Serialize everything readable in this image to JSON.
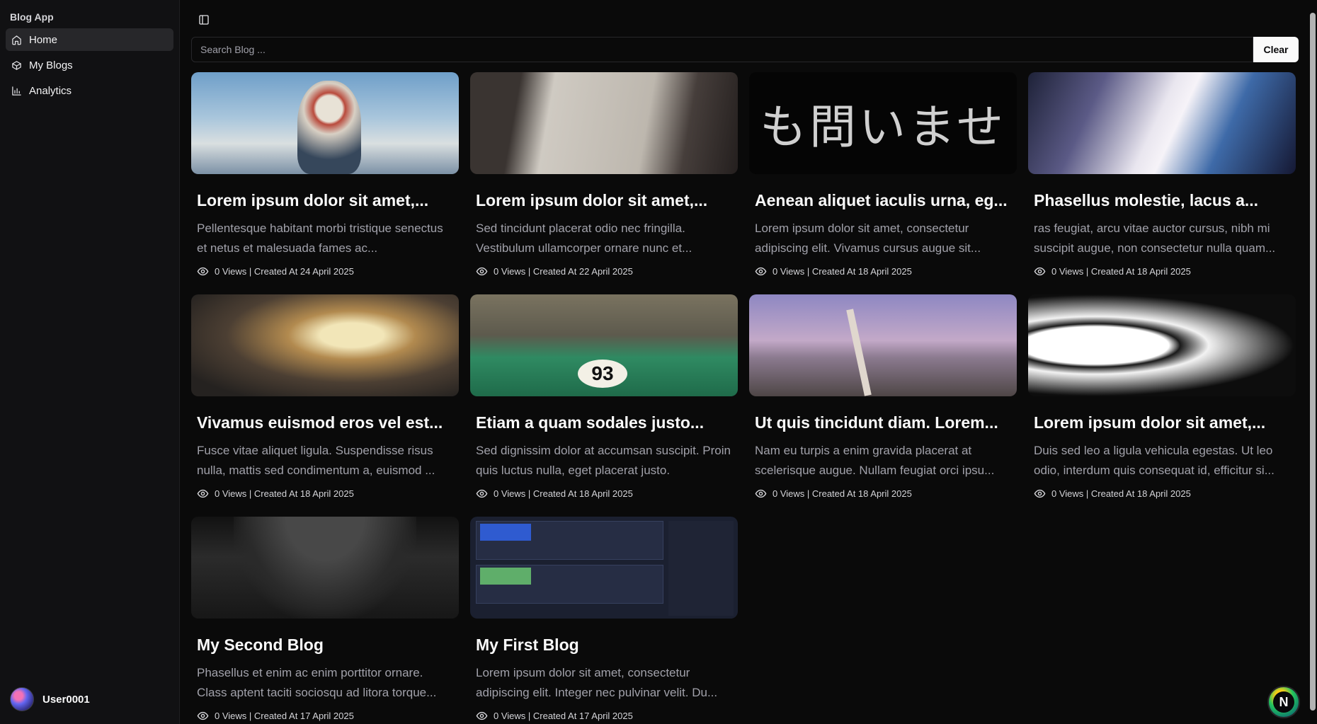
{
  "sidebar": {
    "app_name": "Blog App",
    "items": [
      {
        "label": "Home",
        "icon": "home-icon"
      },
      {
        "label": "My Blogs",
        "icon": "package-icon"
      },
      {
        "label": "Analytics",
        "icon": "chart-icon"
      }
    ],
    "user": {
      "name": "User0001"
    }
  },
  "search": {
    "placeholder": "Search Blog ...",
    "value": "",
    "clear_label": "Clear"
  },
  "posts": [
    {
      "title": "Lorem ipsum dolor sit amet,...",
      "desc": "Pellentesque habitant morbi tristique senectus et netus et malesuada fames ac...",
      "meta": "0 Views | Created At 24 April 2025"
    },
    {
      "title": "Lorem ipsum dolor sit amet,...",
      "desc": "Sed tincidunt placerat odio nec fringilla. Vestibulum ullamcorper ornare nunc et...",
      "meta": "0 Views | Created At 22 April 2025"
    },
    {
      "title": "Aenean aliquet iaculis urna, eg...",
      "desc": "Lorem ipsum dolor sit amet, consectetur adipiscing elit. Vivamus cursus augue sit...",
      "meta": "0 Views | Created At 18 April 2025",
      "image_text": "も問いませ"
    },
    {
      "title": "Phasellus molestie, lacus a...",
      "desc": "ras feugiat, arcu vitae auctor cursus, nibh mi suscipit augue, non consectetur nulla quam...",
      "meta": "0 Views | Created At 18 April 2025"
    },
    {
      "title": "Vivamus euismod eros vel est...",
      "desc": "Fusce vitae aliquet ligula. Suspendisse risus nulla, mattis sed condimentum a, euismod ...",
      "meta": "0 Views | Created At 18 April 2025"
    },
    {
      "title": "Etiam a quam sodales justo...",
      "desc": "Sed dignissim dolor at accumsan suscipit. Proin quis luctus nulla, eget placerat justo.",
      "meta": "0 Views | Created At 18 April 2025",
      "image_text": "93"
    },
    {
      "title": "Ut quis tincidunt diam. Lorem...",
      "desc": "Nam eu turpis a enim gravida placerat at scelerisque augue. Nullam feugiat orci ipsu...",
      "meta": "0 Views | Created At 18 April 2025"
    },
    {
      "title": "Lorem ipsum dolor sit amet,...",
      "desc": "Duis sed leo a ligula vehicula egestas. Ut leo odio, interdum quis consequat id, efficitur si...",
      "meta": "0 Views | Created At 18 April 2025"
    },
    {
      "title": "My Second Blog",
      "desc": "Phasellus et enim ac enim porttitor ornare. Class aptent taciti sociosqu ad litora torque...",
      "meta": "0 Views | Created At 17 April 2025"
    },
    {
      "title": "My First Blog",
      "desc": "Lorem ipsum dolor sit amet, consectetur adipiscing elit. Integer nec pulvinar velit. Du...",
      "meta": "0 Views | Created At 17 April 2025"
    }
  ],
  "fab": {
    "label": "N"
  },
  "colors": {
    "background": "#0a0a0a",
    "sidebar": "#111113",
    "text": "#fafafa",
    "muted": "#a1a1aa",
    "active": "#27272a"
  }
}
